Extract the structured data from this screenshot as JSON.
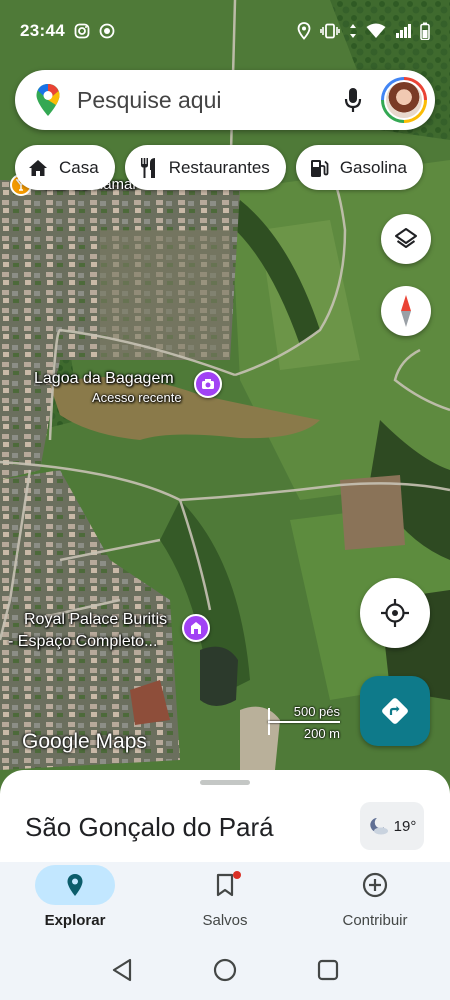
{
  "status_bar": {
    "time": "23:44",
    "icons": [
      "instagram-icon",
      "record-icon",
      "location-icon",
      "vibrate-icon",
      "data-arrows-icon",
      "wifi-icon",
      "signal-icon",
      "battery-icon"
    ]
  },
  "search": {
    "placeholder": "Pesquise aqui"
  },
  "chips": [
    {
      "label": "Casa",
      "icon": "home-icon"
    },
    {
      "label": "Restaurantes",
      "icon": "fork-knife-icon"
    },
    {
      "label": "Gasolina",
      "icon": "gas-station-icon"
    }
  ],
  "map": {
    "labels": {
      "bar": "Bar do Ramal",
      "lagoa_name": "Lagoa da Bagagem",
      "lagoa_sub": "Acesso recente",
      "royal_line1": "Royal Palace Buritis",
      "royal_line2": "- Espaço Completo..."
    },
    "logo": "Google Maps",
    "scale": {
      "imperial": "500 pés",
      "metric": "200 m"
    }
  },
  "sheet": {
    "place": "São Gonçalo do Pará",
    "weather_temp": "19°"
  },
  "nav": [
    {
      "label": "Explorar",
      "icon": "explore-pin-icon",
      "active": true
    },
    {
      "label": "Salvos",
      "icon": "bookmark-icon",
      "active": false
    },
    {
      "label": "Contribuir",
      "icon": "plus-circle-icon",
      "active": false
    }
  ],
  "colors": {
    "accent_teal": "#0b7285",
    "directions_fab": "#0e7a8a",
    "active_pill": "#c2e7ff",
    "poi_purple": "#a142f4",
    "compass_red": "#ea4335"
  }
}
